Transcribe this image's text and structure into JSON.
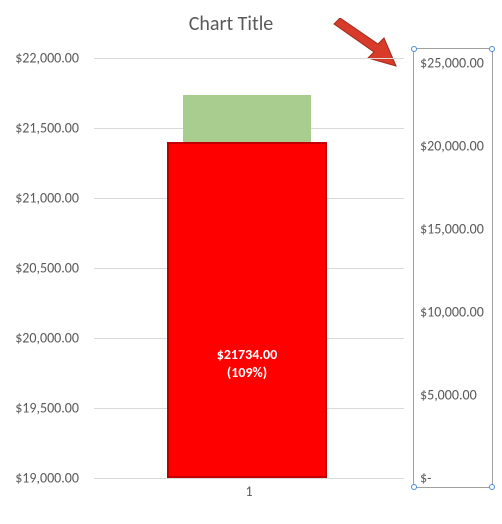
{
  "chart_data": {
    "type": "bar",
    "title": "Chart Title",
    "categories": [
      "1"
    ],
    "series": [
      {
        "name": "green",
        "values": [
          21734
        ],
        "axis": "left",
        "color": "#a8cd8f"
      },
      {
        "name": "red",
        "values": [
          20000
        ],
        "axis": "right",
        "color": "#ff0000",
        "border": "#c00000"
      }
    ],
    "data_label": {
      "text_line1": "$21734.00",
      "text_line2": "(109%)"
    },
    "left_axis": {
      "ticks": [
        "$22,000.00",
        "$21,500.00",
        "$21,000.00",
        "$20,500.00",
        "$20,000.00",
        "$19,500.00",
        "$19,000.00"
      ],
      "ylim": [
        19000,
        22000
      ]
    },
    "right_axis": {
      "ticks": [
        "$25,000.00",
        "$20,000.00",
        "$15,000.00",
        "$10,000.00",
        "$5,000.00",
        "$-"
      ],
      "ylim": [
        0,
        25000
      ],
      "selected": true
    },
    "xlabel": "1",
    "annotation": "arrow pointing to secondary axis"
  }
}
